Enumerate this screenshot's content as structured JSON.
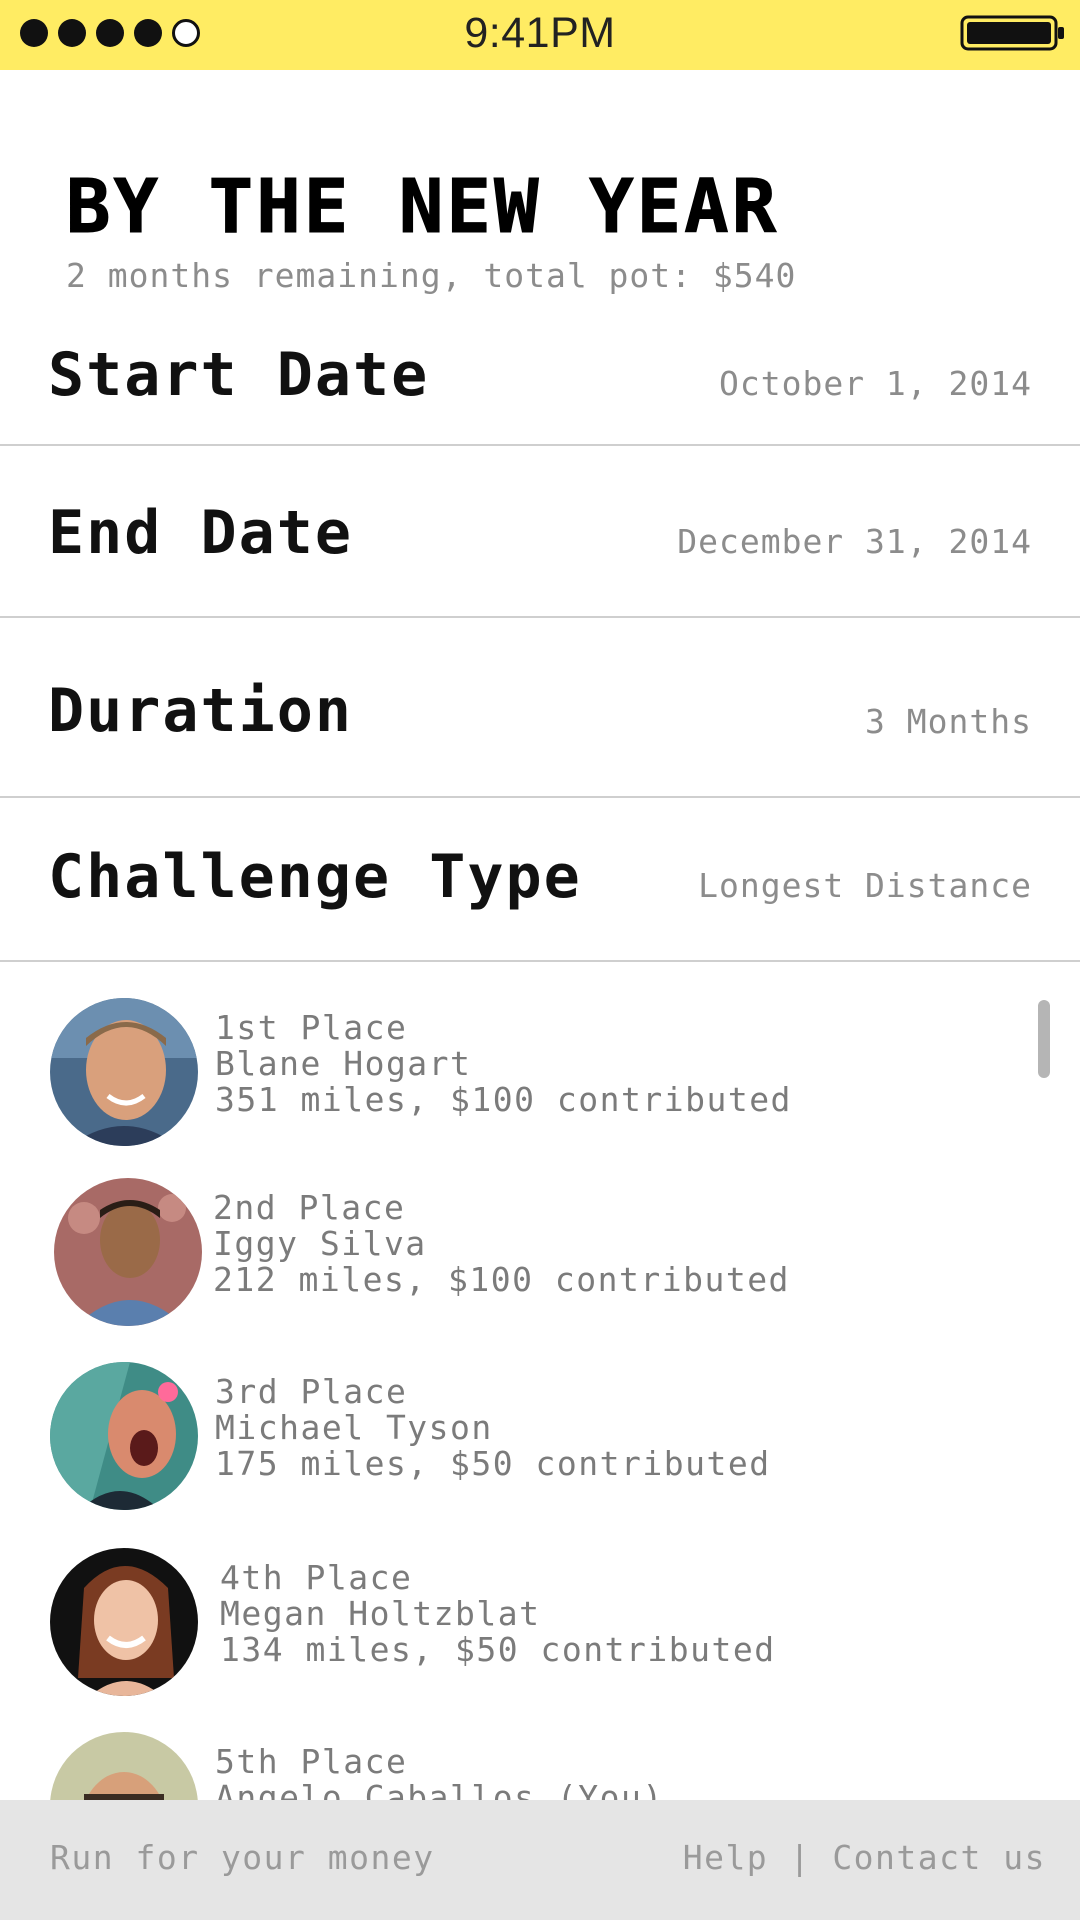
{
  "status_bar": {
    "time": "9:41PM",
    "signal_bars_filled": 4,
    "signal_bars_total": 5,
    "battery": "full",
    "background_color": "#ffec63"
  },
  "header": {
    "title": "BY THE NEW YEAR",
    "subtitle": "2 months remaining, total pot: $540"
  },
  "details": [
    {
      "label": "Start Date",
      "value": "October 1, 2014"
    },
    {
      "label": "End Date",
      "value": "December 31, 2014"
    },
    {
      "label": "Duration",
      "value": "3 Months"
    },
    {
      "label": "Challenge Type",
      "value": "Longest Distance"
    }
  ],
  "leaderboard": [
    {
      "place": "1st Place",
      "name": "Blane Hogart",
      "stats": "351 miles, $100 contributed",
      "avatar": "avatar-photo-1"
    },
    {
      "place": "2nd Place",
      "name": "Iggy Silva",
      "stats": "212 miles, $100 contributed",
      "avatar": "avatar-photo-2"
    },
    {
      "place": "3rd Place",
      "name": "Michael Tyson",
      "stats": "175 miles, $50 contributed",
      "avatar": "avatar-photo-3"
    },
    {
      "place": "4th Place",
      "name": "Megan Holtzblat",
      "stats": "134 miles, $50 contributed",
      "avatar": "avatar-photo-4"
    },
    {
      "place": "5th Place",
      "name": "Angelo Caballos (You)",
      "stats": "",
      "avatar": "avatar-photo-5"
    }
  ],
  "footer": {
    "left": "Run for your money",
    "help": "Help",
    "separator": "|",
    "contact": "Contact us"
  }
}
